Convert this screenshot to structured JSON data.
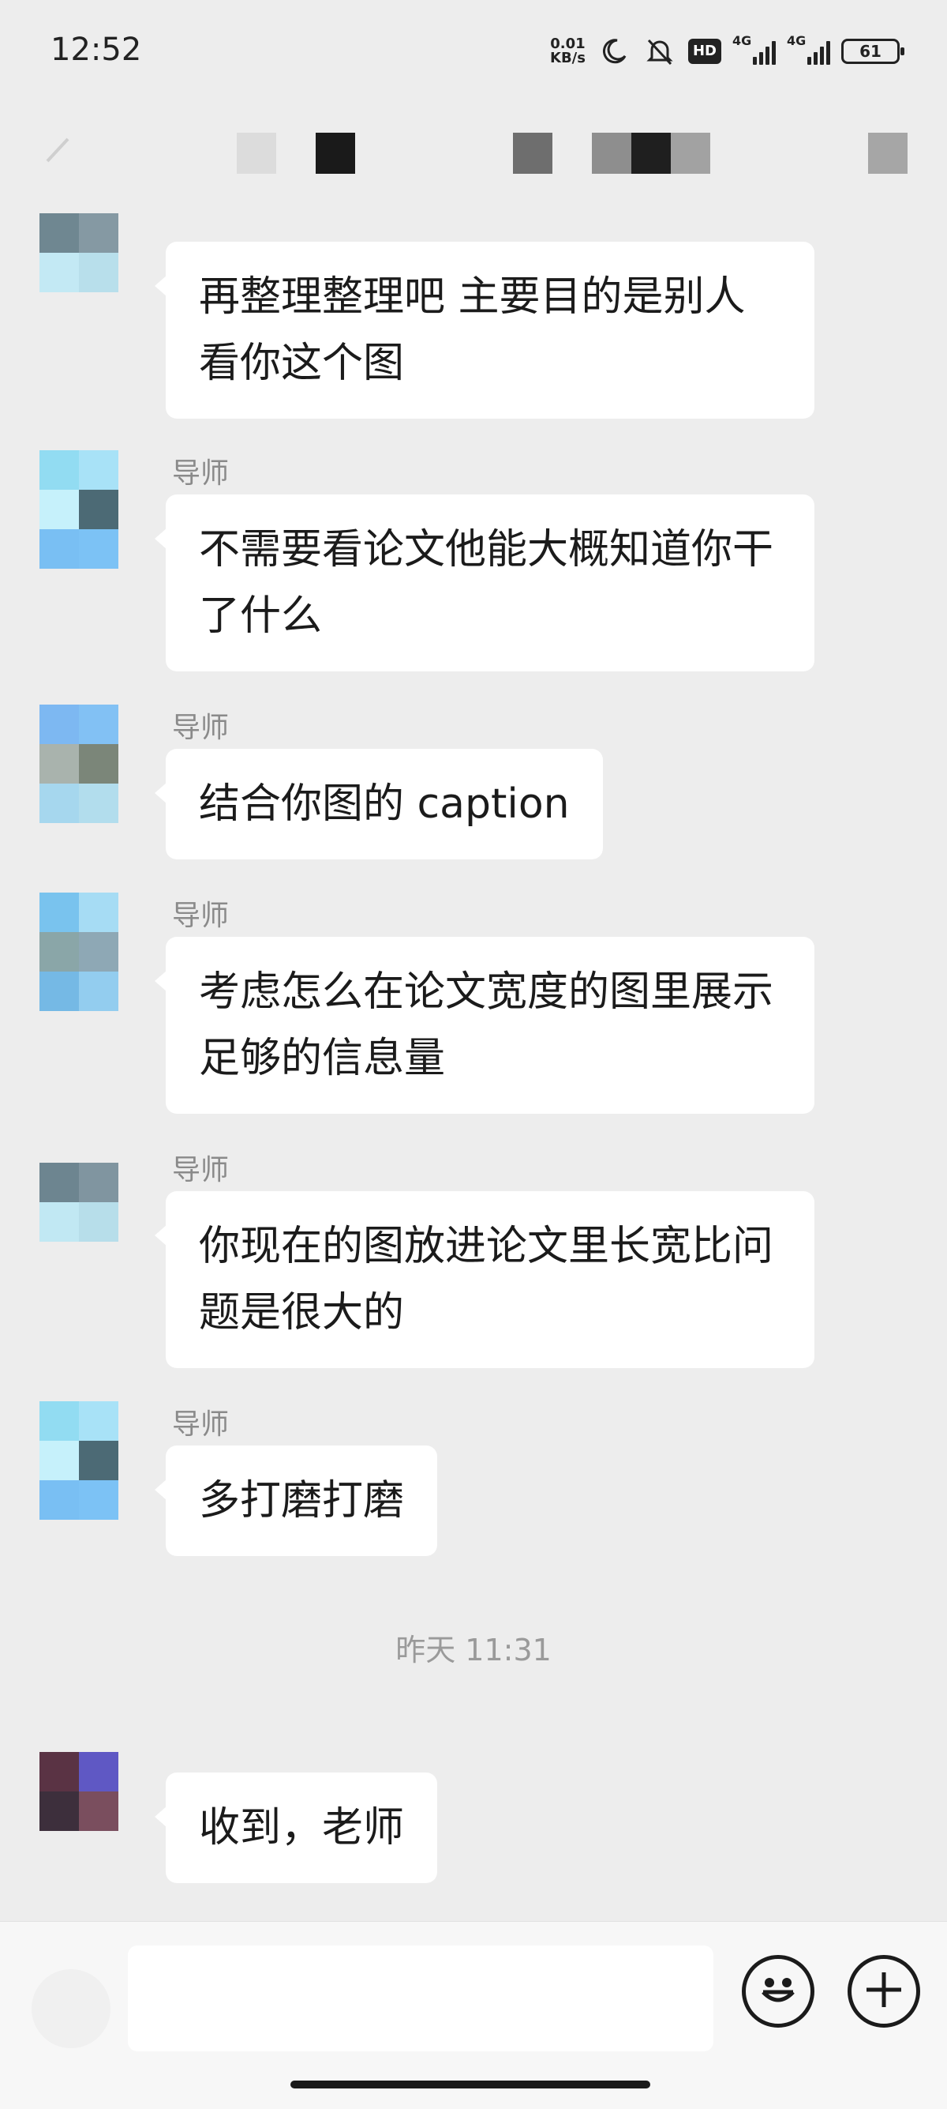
{
  "status_bar": {
    "time": "12:52",
    "net_speed_value": "0.01",
    "net_speed_unit": "KB/s",
    "hd_label": "HD",
    "signal_1": "4G",
    "signal_2": "4G",
    "battery": "61"
  },
  "messages": [
    {
      "sender": "",
      "text": "再整理整理吧 主要目的是别人看你这个图"
    },
    {
      "sender": "导师",
      "text": "不需要看论文他能大概知道你干了什么"
    },
    {
      "sender": "导师",
      "text": "结合你图的 caption"
    },
    {
      "sender": "导师",
      "text": "考虑怎么在论文宽度的图里展示足够的信息量"
    },
    {
      "sender": "导师",
      "text": "你现在的图放进论文里长宽比问题是很大的"
    },
    {
      "sender": "导师",
      "text": "多打磨打磨"
    },
    {
      "sender": "",
      "text": "收到，老师"
    }
  ],
  "timestamp": "昨天 11:31",
  "input": {
    "value": "",
    "placeholder": ""
  },
  "icons": [
    "back-arrow-icon",
    "moon-icon",
    "mute-bell-icon",
    "emoji-icon",
    "plus-icon"
  ]
}
